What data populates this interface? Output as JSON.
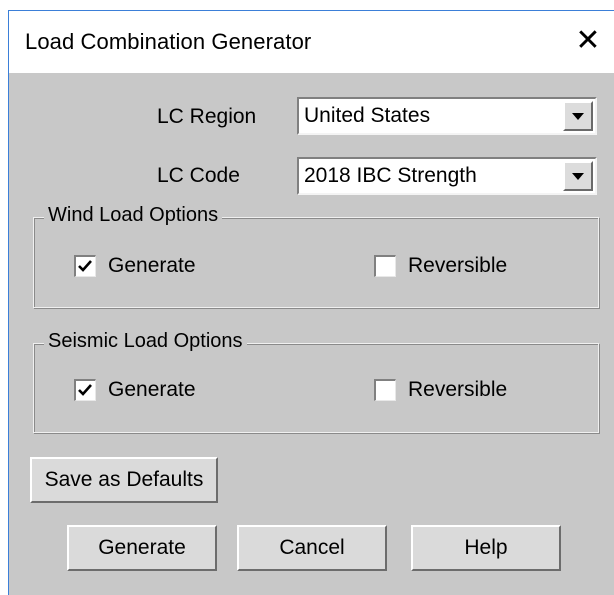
{
  "window": {
    "title": "Load Combination Generator",
    "close_glyph": "✕"
  },
  "lc_region": {
    "label": "LC Region",
    "value": "United States"
  },
  "lc_code": {
    "label": "LC Code",
    "value": "2018 IBC Strength"
  },
  "wind_options": {
    "legend": "Wind Load Options",
    "generate": {
      "label": "Generate",
      "checked": true
    },
    "reversible": {
      "label": "Reversible",
      "checked": false
    }
  },
  "seismic_options": {
    "legend": "Seismic Load Options",
    "generate": {
      "label": "Generate",
      "checked": true
    },
    "reversible": {
      "label": "Reversible",
      "checked": false
    }
  },
  "buttons": {
    "save_defaults": "Save as Defaults",
    "generate": "Generate",
    "cancel": "Cancel",
    "help": "Help"
  },
  "colors": {
    "dialog_bg": "#c8c8c8",
    "titlebar_bg": "#ffffff",
    "window_border": "#3b7fd8"
  },
  "icons": {
    "close": "close-icon",
    "dropdown": "chevron-down-icon",
    "check": "checkmark-icon"
  }
}
